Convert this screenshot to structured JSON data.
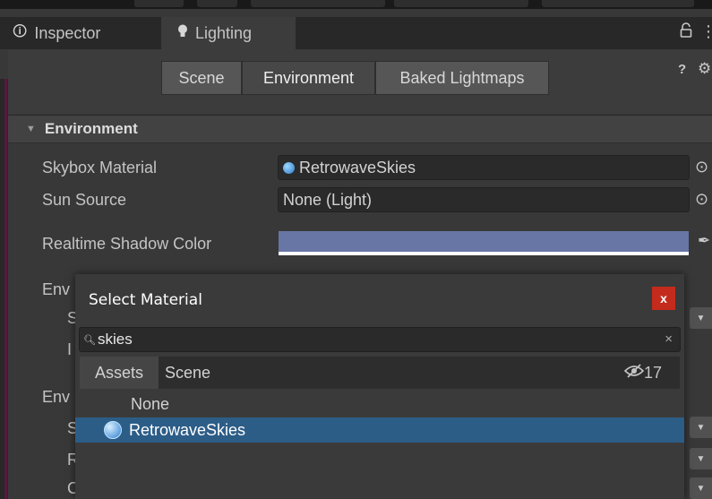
{
  "tabs": {
    "inspector": "Inspector",
    "lighting": "Lighting",
    "lock_icon": "lock-icon",
    "menu_icon": "kebab-menu-icon"
  },
  "lighting_tabs": {
    "scene": "Scene",
    "environment": "Environment",
    "baked": "Baked Lightmaps",
    "active": "Environment"
  },
  "section": {
    "title": "Environment"
  },
  "properties": {
    "skybox_label": "Skybox Material",
    "skybox_value": "RetrowaveSkies",
    "sun_label": "Sun Source",
    "sun_value": "None (Light)",
    "shadow_label": "Realtime Shadow Color",
    "shadow_color": "#6876a5"
  },
  "partial_labels": {
    "env1": "Env",
    "s1": "S",
    "i1": "I",
    "env2": "Env",
    "s2": "S",
    "r2": "R",
    "c2": "C"
  },
  "popup": {
    "title": "Select Material",
    "close": "x",
    "search_value": "skies",
    "clear": "×",
    "tab_assets": "Assets",
    "tab_scene": "Scene",
    "hidden_count": "17",
    "items": [
      "None",
      "RetrowaveSkies"
    ],
    "selected": "RetrowaveSkies"
  },
  "colors": {
    "selection": "#2c5d87",
    "close_button": "#c42b1c",
    "accent_line": "#5b1640"
  }
}
